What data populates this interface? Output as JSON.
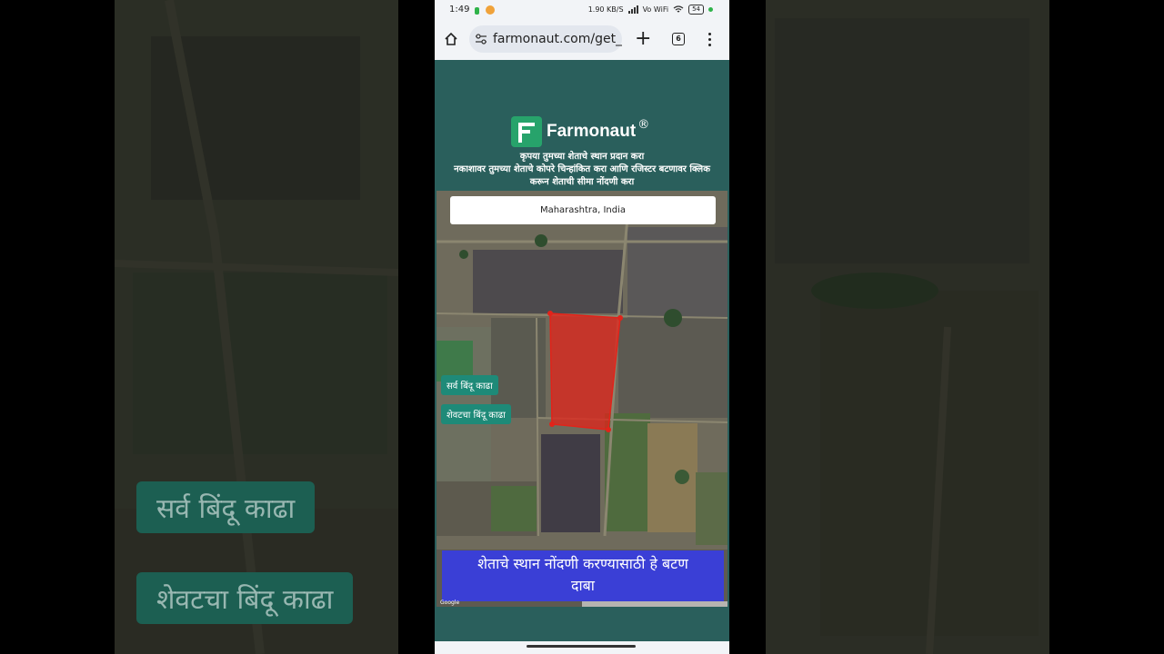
{
  "status_bar": {
    "time": "1:49",
    "net_speed": "1.90 KB/S",
    "wifi_label": "Vo WiFi",
    "battery": "54"
  },
  "browser": {
    "url": "farmonaut.com/get_",
    "tab_count": "6"
  },
  "brand": {
    "name": "Farmonaut",
    "reg": "®",
    "accent": "#27a36b"
  },
  "instructions": {
    "line1": "कृपया तुमच्या शेताचे स्थान प्रदान करा",
    "line2": "नकाशावर तुमच्या शेताचे कोपरे चिन्हांकित करा आणि रजिस्टर बटणावर क्लिक",
    "line3": "करून शेताची सीमा नोंदणी करा"
  },
  "map": {
    "location_value": "Maharashtra, India",
    "clear_all_points": "सर्व बिंदू काढा",
    "remove_last_point": "शेवटचा बिंदू काढा",
    "polygon_color": "#e2231a",
    "google_mark": "Google"
  },
  "register_button": {
    "line1": "शेताचे स्थान नोंदणी करण्यासाठी हे बटण",
    "line2": "दाबा",
    "color": "#3a3fd6"
  },
  "background": {
    "chip1": "सर्व बिंदू काढा",
    "chip2": "शेवटचा बिंदू काढा"
  }
}
